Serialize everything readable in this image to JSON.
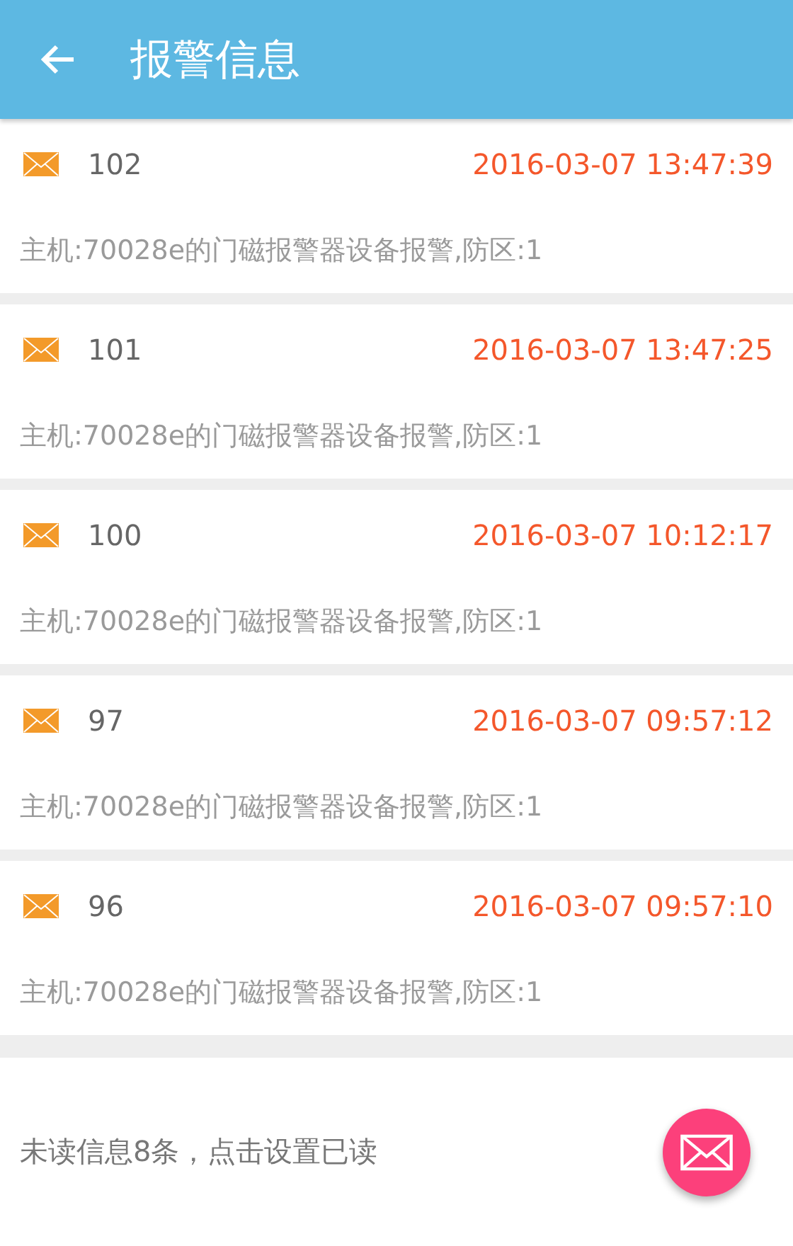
{
  "header": {
    "title": "报警信息"
  },
  "alarms": [
    {
      "id": "102",
      "time": "2016-03-07 13:47:39",
      "message": "主机:70028e的门磁报警器设备报警,防区:1"
    },
    {
      "id": "101",
      "time": "2016-03-07 13:47:25",
      "message": "主机:70028e的门磁报警器设备报警,防区:1"
    },
    {
      "id": "100",
      "time": "2016-03-07 10:12:17",
      "message": "主机:70028e的门磁报警器设备报警,防区:1"
    },
    {
      "id": "97",
      "time": "2016-03-07 09:57:12",
      "message": "主机:70028e的门磁报警器设备报警,防区:1"
    },
    {
      "id": "96",
      "time": "2016-03-07 09:57:10",
      "message": "主机:70028e的门磁报警器设备报警,防区:1"
    }
  ],
  "footer": {
    "text": "未读信息8条，点击设置已读"
  }
}
